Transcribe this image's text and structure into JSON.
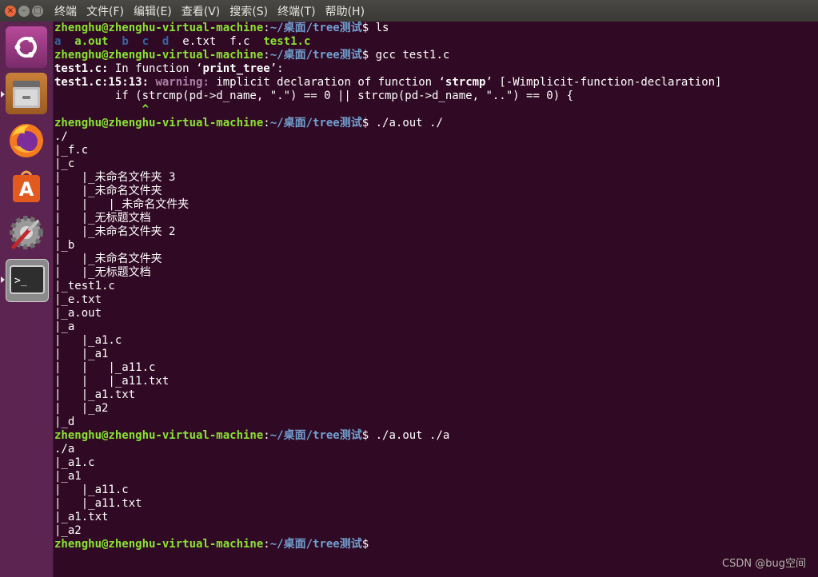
{
  "window": {
    "menu": [
      "终端",
      "文件(F)",
      "编辑(E)",
      "查看(V)",
      "搜索(S)",
      "终端(T)",
      "帮助(H)"
    ]
  },
  "launcher": {
    "items": [
      {
        "name": "ubuntu-dash-icon"
      },
      {
        "name": "file-manager-icon"
      },
      {
        "name": "firefox-icon"
      },
      {
        "name": "software-center-icon"
      },
      {
        "name": "system-settings-icon"
      },
      {
        "name": "terminal-icon"
      }
    ]
  },
  "terminal": {
    "prompt_user": "zhenghu@zhenghu-virtual-machine",
    "prompt_path": "~/桌面/tree测试",
    "cmd1": "ls",
    "ls_output": [
      "a",
      "a.out",
      "b",
      "c",
      "d",
      "e.txt",
      "f.c",
      "test1.c"
    ],
    "cmd2": "gcc test1.c",
    "warn_file": "test1.c:",
    "warn_infunc": "In function ‘",
    "warn_func": "print_tree",
    "warn_func_end": "’:",
    "warn_loc": "test1.c:15:13:",
    "warn_label": "warning:",
    "warn_msg": "implicit declaration of function ‘",
    "warn_fn": "strcmp",
    "warn_flag": "’ [-Wimplicit-function-declaration]",
    "warn_code": "         if (strcmp(pd->d_name, \".\") == 0 || strcmp(pd->d_name, \"..\") == 0) {",
    "warn_caret": "             ^",
    "cmd3": "./a.out ./",
    "tree1": [
      "./",
      "|_f.c",
      "|_c",
      "|   |_未命名文件夹 3",
      "|   |_未命名文件夹",
      "|   |   |_未命名文件夹",
      "|   |_无标题文档",
      "|   |_未命名文件夹 2",
      "|_b",
      "|   |_未命名文件夹",
      "|   |_无标题文档",
      "|_test1.c",
      "|_e.txt",
      "|_a.out",
      "|_a",
      "|   |_a1.c",
      "|   |_a1",
      "|   |   |_a11.c",
      "|   |   |_a11.txt",
      "|   |_a1.txt",
      "|   |_a2",
      "|_d"
    ],
    "cmd4": "./a.out ./a",
    "tree2": [
      "./a",
      "|_a1.c",
      "|_a1",
      "|   |_a11.c",
      "|   |_a11.txt",
      "|_a1.txt",
      "|_a2"
    ]
  },
  "watermark": "CSDN @bug空间"
}
